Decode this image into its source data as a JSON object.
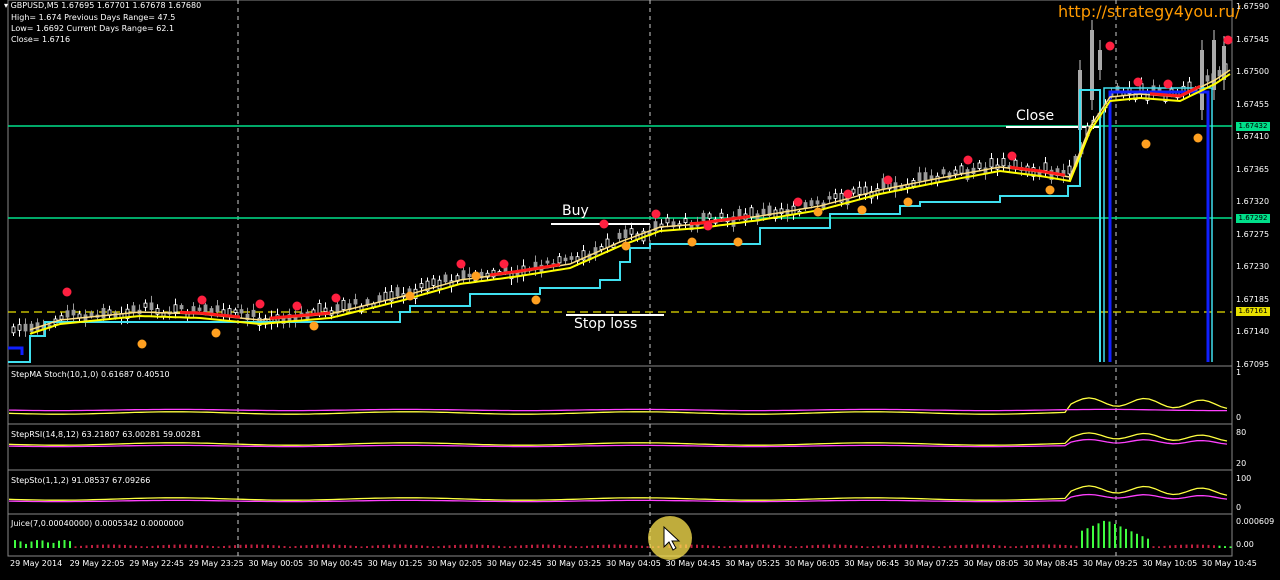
{
  "header": {
    "symbol_line": "GBPUSD,M5  1.67695 1.67701 1.67678 1.67680",
    "lines": [
      "High= 1.674    Previous Days Range= 47.5",
      "Low= 1.6692    Current Days Range= 62.1",
      "Close= 1.6716"
    ]
  },
  "watermark": "http://strategy4you.ru/",
  "annotations": {
    "buy": "Buy",
    "stop_loss": "Stop loss",
    "close": "Close"
  },
  "price_scale": [
    "1.67590",
    "1.67545",
    "1.67500",
    "1.67455",
    "1.67410",
    "1.67365",
    "1.67320",
    "1.67275",
    "1.67230",
    "1.67185",
    "1.67140",
    "1.67095"
  ],
  "price_badges": {
    "close_level": "1.67432",
    "buy_level": "1.67292",
    "stop_level": "1.67161"
  },
  "time_labels": [
    "29 May 2014",
    "29 May 22:05",
    "29 May 22:45",
    "29 May 23:25",
    "30 May 00:05",
    "30 May 00:45",
    "30 May 01:25",
    "30 May 02:05",
    "30 May 02:45",
    "30 May 03:25",
    "30 May 04:05",
    "30 May 04:45",
    "30 May 05:25",
    "30 May 06:05",
    "30 May 06:45",
    "30 May 07:25",
    "30 May 08:05",
    "30 May 08:45",
    "30 May 09:25",
    "30 May 10:05",
    "30 May 10:45"
  ],
  "panels": [
    {
      "label": "StepMA Stoch(10,1,0) 0.61687 0.40510",
      "scale_top": "1",
      "scale_bottom": "0"
    },
    {
      "label": "StepRSI(14,8,12) 63.21807 63.00281 59.00281",
      "scale_top": "80",
      "scale_bottom": "20"
    },
    {
      "label": "StepSto(1,1,2) 91.08537 67.09266",
      "scale_top": "100",
      "scale_bottom": "0"
    },
    {
      "label": "Juice(7,0.00040000) 0.0005342 0.0000000",
      "scale_top": "0.000609",
      "scale_bottom": "0.00"
    }
  ],
  "colors": {
    "background": "#000000",
    "level_lines": "#00e08a",
    "stop_line": "#e8e000",
    "ma_yellow": "#ffff00",
    "ma_red": "#ff1a1a",
    "step_cyan": "#40e0f0",
    "step_blue": "#1020ff",
    "dot_red": "#ff2040",
    "dot_orange": "#ffa020",
    "osc_yellow": "#ffff40",
    "osc_magenta": "#ff40ff",
    "juice_green": "#40ff40"
  }
}
